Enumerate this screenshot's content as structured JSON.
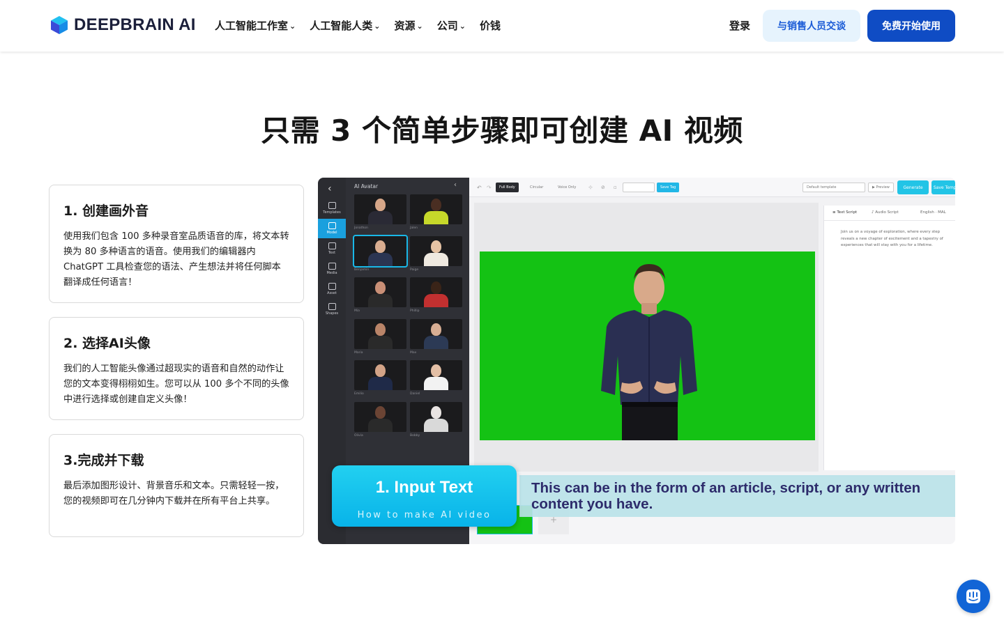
{
  "header": {
    "brand": "DEEPBRAIN AI",
    "nav": [
      {
        "label": "人工智能工作室",
        "has_dropdown": true
      },
      {
        "label": "人工智能人类",
        "has_dropdown": true
      },
      {
        "label": "资源",
        "has_dropdown": true
      },
      {
        "label": "公司",
        "has_dropdown": true
      },
      {
        "label": "价钱",
        "has_dropdown": false
      }
    ],
    "login": "登录",
    "sales_button": "与销售人员交谈",
    "free_button": "免费开始使用"
  },
  "headline": "只需 3 个简单步骤即可创建 AI 视频",
  "steps": [
    {
      "title": "1. 创建画外音",
      "body": "使用我们包含 100 多种录音室品质语音的库，将文本转换为 80 多种语言的语音。使用我们的编辑器内 ChatGPT 工具检查您的语法、产生想法并将任何脚本翻译成任何语言！"
    },
    {
      "title": "2. 选择AI头像",
      "body": "我们的人工智能头像通过超现实的语音和自然的动作让您的文本变得栩栩如生。您可以从 100 多个不同的头像中进行选择或创建自定义头像！"
    },
    {
      "title": "3.完成并下载",
      "body": "最后添加图形设计、背景音乐和文本。只需轻轻一按，您的视频即可在几分钟内下载并在所有平台上共享。"
    }
  ],
  "editor": {
    "rail": [
      "Templates",
      "Model",
      "Text",
      "Media",
      "Asset",
      "Shapes"
    ],
    "panel_title": "AI Avatar",
    "avatars": [
      "Jonathon",
      "Jalen",
      "Benjamin",
      "Paige",
      "Mia",
      "Phillip",
      "Maria",
      "Max",
      "Emilio",
      "Daniel",
      "Olivia",
      "Bobby"
    ],
    "toolbar": {
      "full_body": "Full Body",
      "circular": "Circular",
      "voice_only": "Voice Only",
      "save_tag": "Save Tag",
      "template": "Default template",
      "preview": "Preview",
      "generate": "Generate",
      "save_template": "Save Templ"
    },
    "script_tabs": [
      "Text Script",
      "Audio Script",
      "English · MAL"
    ],
    "script_text": "Join us on a voyage of exploration, where every step reveals a new chapter of excitement and a tapestry of experiences that will stay with you for a lifetime.",
    "step_label": "1. Input Text",
    "step_sub": "How to make AI video",
    "caption": "This can be in the form of an article, script, or any written content you have."
  },
  "colors": {
    "primary": "#0f4cc4",
    "accent": "#22c4e6",
    "green_screen": "#14c214"
  }
}
